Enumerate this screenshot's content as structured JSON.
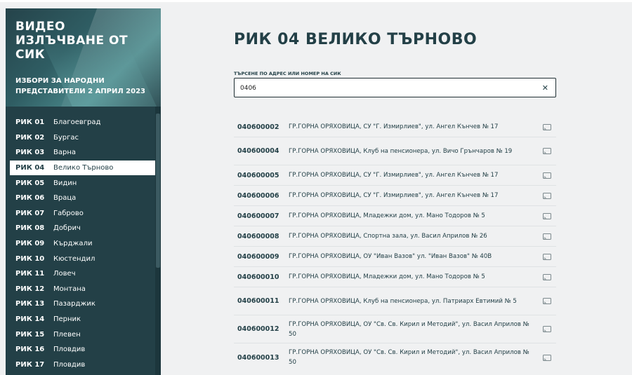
{
  "sidebar": {
    "brand_title": "ВИДЕО ИЗЛЪЧВАНЕ ОТ СИК",
    "brand_subtitle": "ИЗБОРИ ЗА НАРОДНИ ПРЕДСТАВИТЕЛИ 2 АПРИЛ 2023",
    "items": [
      {
        "code": "РИК 01",
        "name": "Благоевград"
      },
      {
        "code": "РИК 02",
        "name": "Бургас"
      },
      {
        "code": "РИК 03",
        "name": "Варна"
      },
      {
        "code": "РИК 04",
        "name": "Велико Търново"
      },
      {
        "code": "РИК 05",
        "name": "Видин"
      },
      {
        "code": "РИК 06",
        "name": "Враца"
      },
      {
        "code": "РИК 07",
        "name": "Габрово"
      },
      {
        "code": "РИК 08",
        "name": "Добрич"
      },
      {
        "code": "РИК 09",
        "name": "Кърджали"
      },
      {
        "code": "РИК 10",
        "name": "Кюстендил"
      },
      {
        "code": "РИК 11",
        "name": "Ловеч"
      },
      {
        "code": "РИК 12",
        "name": "Монтана"
      },
      {
        "code": "РИК 13",
        "name": "Пазарджик"
      },
      {
        "code": "РИК 14",
        "name": "Перник"
      },
      {
        "code": "РИК 15",
        "name": "Плевен"
      },
      {
        "code": "РИК 16",
        "name": "Пловдив"
      },
      {
        "code": "РИК 17",
        "name": "Пловдив"
      }
    ],
    "active_index": 3
  },
  "main": {
    "title": "РИК 04 ВЕЛИКО ТЪРНОВО",
    "search": {
      "label": "ТЪРСЕНЕ ПО АДРЕС ИЛИ НОМЕР НА СИК",
      "value": "0406",
      "placeholder": "",
      "clear_icon": "close-icon"
    },
    "results": [
      {
        "number": "040600002",
        "address": "ГР.ГОРНА ОРЯХОВИЦА, СУ \"Г. Измирлиев\", ул. Ангел Кънчев № 17"
      },
      {
        "number": "040600004",
        "address": "ГР.ГОРНА ОРЯХОВИЦА, Клуб на пенсионера, ул. Вичо Грънчаров № 19"
      },
      {
        "number": "040600005",
        "address": "ГР.ГОРНА ОРЯХОВИЦА, СУ \"Г. Измирлиев\", ул. Ангел Кънчев № 17"
      },
      {
        "number": "040600006",
        "address": "ГР.ГОРНА ОРЯХОВИЦА, СУ \"Г. Измирлиев\", ул. Ангел Кънчев № 17"
      },
      {
        "number": "040600007",
        "address": "ГР.ГОРНА ОРЯХОВИЦА, Младежки дом, ул. Мано Тодоров № 5"
      },
      {
        "number": "040600008",
        "address": "ГР.ГОРНА ОРЯХОВИЦА, Спортна зала, ул. Васил Априлов № 26"
      },
      {
        "number": "040600009",
        "address": "ГР.ГОРНА ОРЯХОВИЦА, ОУ \"Иван Вазов\" ул. \"Иван Вазов\" № 40В"
      },
      {
        "number": "040600010",
        "address": "ГР.ГОРНА ОРЯХОВИЦА, Младежки дом, ул. Мано Тодоров № 5"
      },
      {
        "number": "040600011",
        "address": "ГР.ГОРНА ОРЯХОВИЦА, Клуб на пенсионера, ул. Патриарх Евтимий № 5"
      },
      {
        "number": "040600012",
        "address": "ГР.ГОРНА ОРЯХОВИЦА, ОУ \"Св. Св. Кирил и Методий\", ул. Васил Априлов № 50"
      },
      {
        "number": "040600013",
        "address": "ГР.ГОРНА ОРЯХОВИЦА, ОУ \"Св. Св. Кирил и Методий\", ул. Васил Априлов № 50"
      }
    ],
    "row_icon": "cast-icon"
  },
  "colors": {
    "sidebar_bg": "#234047",
    "accent_text": "#234047",
    "page_bg": "#f0f1f2"
  }
}
